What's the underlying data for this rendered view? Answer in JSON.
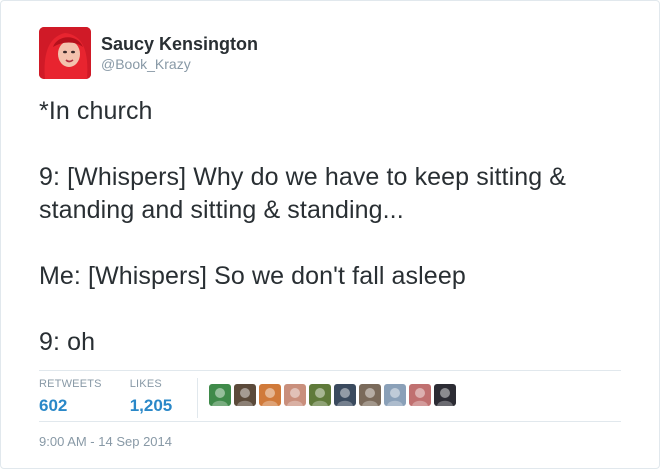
{
  "user": {
    "display_name": "Saucy Kensington",
    "handle": "@Book_Krazy"
  },
  "tweet": {
    "paragraphs": [
      "*In church",
      "9: [Whispers] Why do we have to keep sitting & standing and sitting & standing...",
      "Me: [Whispers] So we don't fall asleep",
      "9: oh"
    ]
  },
  "stats": {
    "retweets_label": "RETWEETS",
    "retweets_value": "602",
    "likes_label": "LIKES",
    "likes_value": "1,205"
  },
  "likers": [
    {
      "icon": "avatar-robot-icon",
      "color": "#3f8a4a"
    },
    {
      "icon": "avatar-character-icon",
      "color": "#5b4a3a"
    },
    {
      "icon": "avatar-redhead-icon",
      "color": "#d07a3a"
    },
    {
      "icon": "avatar-face-icon",
      "color": "#c98f7c"
    },
    {
      "icon": "avatar-landscape-icon",
      "color": "#5f7a3a"
    },
    {
      "icon": "avatar-group-icon",
      "color": "#3a4a5e"
    },
    {
      "icon": "avatar-man-icon",
      "color": "#7a6a5a"
    },
    {
      "icon": "avatar-person-icon",
      "color": "#8aa0b8"
    },
    {
      "icon": "avatar-woman-icon",
      "color": "#c07070"
    },
    {
      "icon": "avatar-dark-icon",
      "color": "#2c2c34"
    }
  ],
  "timestamp": "9:00 AM - 14 Sep 2014",
  "colors": {
    "link_blue": "#2a88c8",
    "muted_gray": "#8899a6",
    "text": "#292f33"
  }
}
